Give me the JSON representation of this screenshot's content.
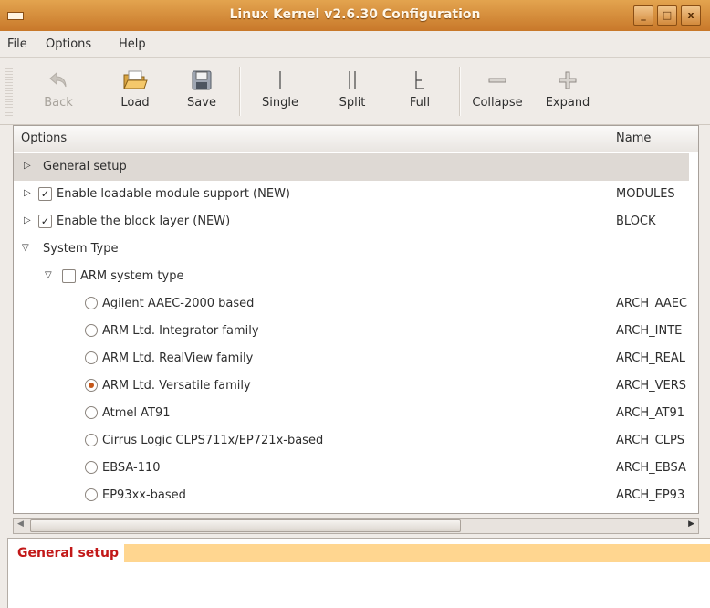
{
  "window": {
    "title": "Linux Kernel v2.6.30 Configuration",
    "buttons": [
      "_",
      "□",
      "x"
    ]
  },
  "menu": [
    "File",
    "Options",
    "Help"
  ],
  "toolbar": {
    "back": "Back",
    "load": "Load",
    "save": "Save",
    "single": "Single",
    "split": "Split",
    "full": "Full",
    "collapse": "Collapse",
    "expand": "Expand"
  },
  "tree": {
    "col_options": "Options",
    "col_name": "Name",
    "rows": [
      {
        "label": "General setup",
        "name": "",
        "selected": true
      },
      {
        "label": "Enable loadable module support (NEW)",
        "name": "MODULES",
        "checked": true
      },
      {
        "label": "Enable the block layer (NEW)",
        "name": "BLOCK",
        "checked": true
      },
      {
        "label": "System Type",
        "name": ""
      },
      {
        "label": "ARM system type",
        "name": "",
        "checked": false
      },
      {
        "label": "Agilent AAEC-2000 based",
        "name": "ARCH_AAEC"
      },
      {
        "label": "ARM Ltd. Integrator family",
        "name": "ARCH_INTE"
      },
      {
        "label": "ARM Ltd. RealView family",
        "name": "ARCH_REAL"
      },
      {
        "label": "ARM Ltd. Versatile family",
        "name": "ARCH_VERS",
        "radio_selected": true
      },
      {
        "label": "Atmel AT91",
        "name": "ARCH_AT91"
      },
      {
        "label": "Cirrus Logic CLPS711x/EP721x-based",
        "name": "ARCH_CLPS"
      },
      {
        "label": "EBSA-110",
        "name": "ARCH_EBSA"
      },
      {
        "label": "EP93xx-based",
        "name": "ARCH_EP93"
      }
    ]
  },
  "help_panel": {
    "title": "General setup"
  },
  "colors": {
    "titlebar": "#d28b3c",
    "help_title": "#c21818",
    "help_band": "#ffd690",
    "radio_dot": "#c4571a"
  }
}
